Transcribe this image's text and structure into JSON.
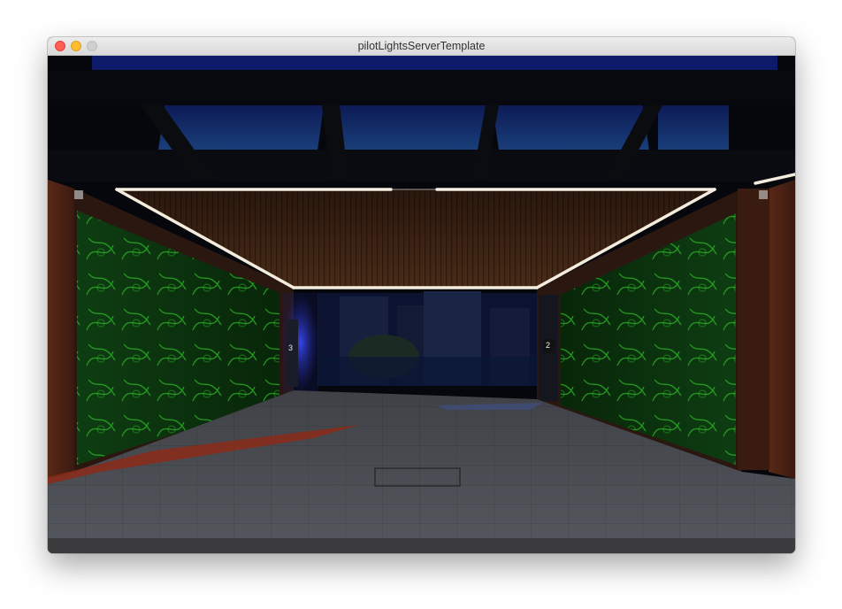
{
  "window": {
    "title": "pilotLightsServerTemplate"
  },
  "scene": {
    "description_icon": "rendered-3d-scene",
    "door_numbers": [
      "3",
      "2"
    ]
  },
  "colors": {
    "close": "#fe5f57",
    "minimize": "#febc2e",
    "zoom": "#d0d0d0",
    "led_strip": "#f4ecdc",
    "green_glow": "#2fbf2a",
    "ceiling_wood": "#3b2314",
    "floor": "#4a4c52"
  }
}
